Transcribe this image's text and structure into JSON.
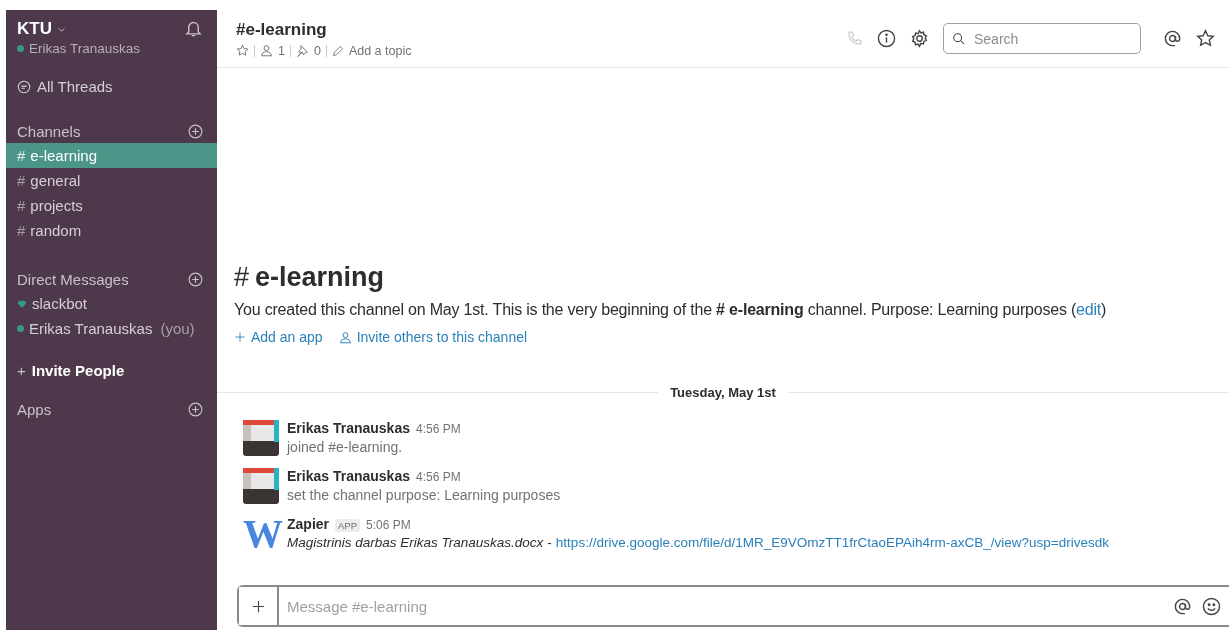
{
  "sidebar": {
    "team": "KTU",
    "user": {
      "name": "Erikas Tranauskas",
      "online": true
    },
    "all_threads": "All Threads",
    "sections": [
      {
        "title": "Channels",
        "items": [
          {
            "kind": "channel",
            "prefix": "#",
            "label": "e-learning",
            "selected": true
          },
          {
            "kind": "channel",
            "prefix": "#",
            "label": "general",
            "selected": false
          },
          {
            "kind": "channel",
            "prefix": "#",
            "label": "projects",
            "selected": false
          },
          {
            "kind": "channel",
            "prefix": "#",
            "label": "random",
            "selected": false
          }
        ]
      },
      {
        "title": "Direct Messages",
        "items": [
          {
            "kind": "bot",
            "label": "slackbot",
            "selected": false
          },
          {
            "kind": "user",
            "label": "Erikas Tranauskas",
            "suffix": "(you)",
            "selected": false
          }
        ]
      }
    ],
    "invite": {
      "prefix": "+",
      "label": "Invite People"
    },
    "apps": {
      "title": "Apps"
    }
  },
  "header": {
    "title": "#e-learning",
    "members": "1",
    "pins": "0",
    "topic": "Add a topic",
    "search": {
      "placeholder": "Search"
    }
  },
  "intro": {
    "hash": "#",
    "title": "e-learning",
    "text_before": "You created this channel on May 1st. This is the very beginning of the  **# e-learning** channel. Purpose: Learning purposes (",
    "link": "edit",
    "text_after": ")",
    "actions": [
      {
        "kind": "add",
        "label": "Add an app"
      },
      {
        "kind": "invite",
        "label": "Invite others to this channel"
      }
    ]
  },
  "date_divider": "Tuesday, May 1st",
  "messages": [
    {
      "kind": "user",
      "author": "Erikas Tranauskas",
      "time": "4:56 PM",
      "text": "joined #e-learning."
    },
    {
      "kind": "user",
      "author": "Erikas Tranauskas",
      "time": "4:56 PM",
      "text": "set the channel purpose: Learning purposes"
    },
    {
      "kind": "app",
      "avatar_letter": "W",
      "author": "Zapier",
      "badge": "APP",
      "time": "5:06 PM",
      "file": "Magistrinis darbas Erikas Tranauskas.docx",
      "separator": "-",
      "link": "https://drive.google.com/file/d/1MR_E9VOmzTT1frCtaoEPAih4rm-axCB_/view?usp=drivesdk"
    }
  ],
  "composer": {
    "placeholder": "Message #e-learning"
  }
}
